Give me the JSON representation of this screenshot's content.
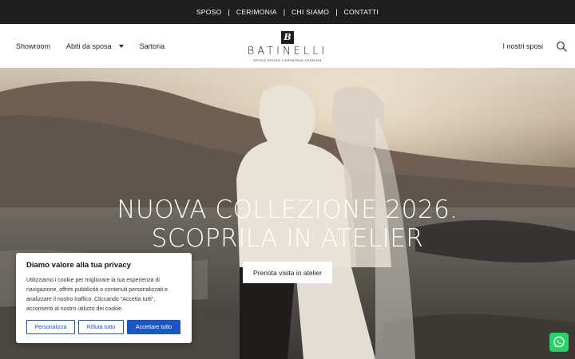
{
  "topbar": {
    "links": [
      "SPOSO",
      "CERIMONIA",
      "CHI SIAMO",
      "CONTATTI"
    ],
    "separator": "|"
  },
  "nav": {
    "showroom": "Showroom",
    "abiti": "Abiti da sposa",
    "sartoria": "Sartoria",
    "nostri_sposi": "I nostri sposi"
  },
  "logo": {
    "mark": "B",
    "word": "BATINELLI",
    "tagline": "SPOSA SPOSO CERIMONIA FASHION"
  },
  "hero": {
    "title_line1": "NUOVA COLLEZIONE 2026.",
    "title_line2": "SCOPRILA IN ATELIER",
    "cta": "Prenota visita in atelier"
  },
  "cookie": {
    "title": "Diamo valore alla tua privacy",
    "body": "Utilizziamo i cookie per migliorare la tua esperienza di navigazione, offrirti pubblicità o contenuti personalizzati e analizzare il nostro traffico. Cliccando \"Accetta tutti\", acconsenti al nostro utilizzo dei cookie.",
    "customize": "Personalizza",
    "reject": "Rifiuta tutto",
    "accept": "Accettare tutto"
  },
  "colors": {
    "topbar_bg": "#1e1e1e",
    "accent_blue": "#1a56c4",
    "whatsapp": "#25d366"
  }
}
